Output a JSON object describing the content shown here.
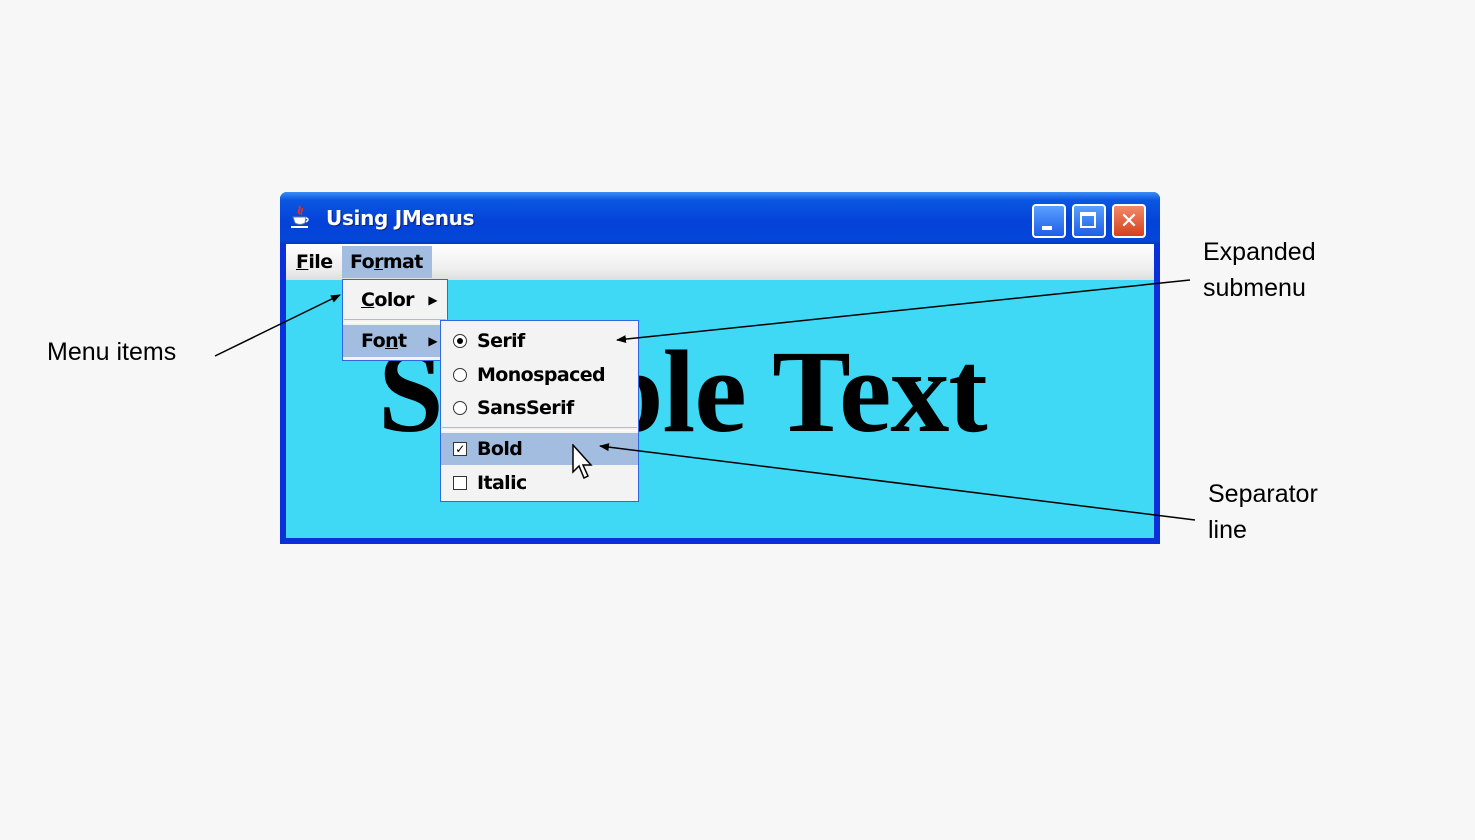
{
  "window": {
    "title": "Using JMenus",
    "buttons": {
      "close_glyph": "✕"
    }
  },
  "menubar": {
    "file": {
      "first": "F",
      "rest": "ile"
    },
    "format": {
      "before": "Fo",
      "underlined": "r",
      "after": "mat"
    }
  },
  "format_menu": {
    "color": {
      "first": "C",
      "rest": "olor",
      "arrow": "▶"
    },
    "font": {
      "before": "Fo",
      "underlined": "n",
      "after": "t",
      "arrow": "▶"
    }
  },
  "font_menu": {
    "items": [
      {
        "label": "Serif",
        "type": "radio",
        "checked": true
      },
      {
        "label": "Monospaced",
        "type": "radio",
        "checked": false
      },
      {
        "label": "SansSerif",
        "type": "radio",
        "checked": false
      },
      {
        "label": "Bold",
        "type": "checkbox",
        "checked": true,
        "check_glyph": "✓"
      },
      {
        "label": "Italic",
        "type": "checkbox",
        "checked": false,
        "check_glyph": ""
      }
    ]
  },
  "content": {
    "text": "Sample Text",
    "background": "#40d9f5"
  },
  "callouts": {
    "menu_items": "Menu items",
    "expanded_submenu": [
      "Expanded",
      "submenu"
    ],
    "separator_line": [
      "Separator",
      "line"
    ]
  },
  "colors": {
    "title_bar": "#0442d8",
    "menu_highlight": "#a3bde0",
    "close_button": "#d6401c"
  },
  "icons": {
    "app": "java-cup-icon",
    "cursor": "mouse-pointer-icon"
  }
}
